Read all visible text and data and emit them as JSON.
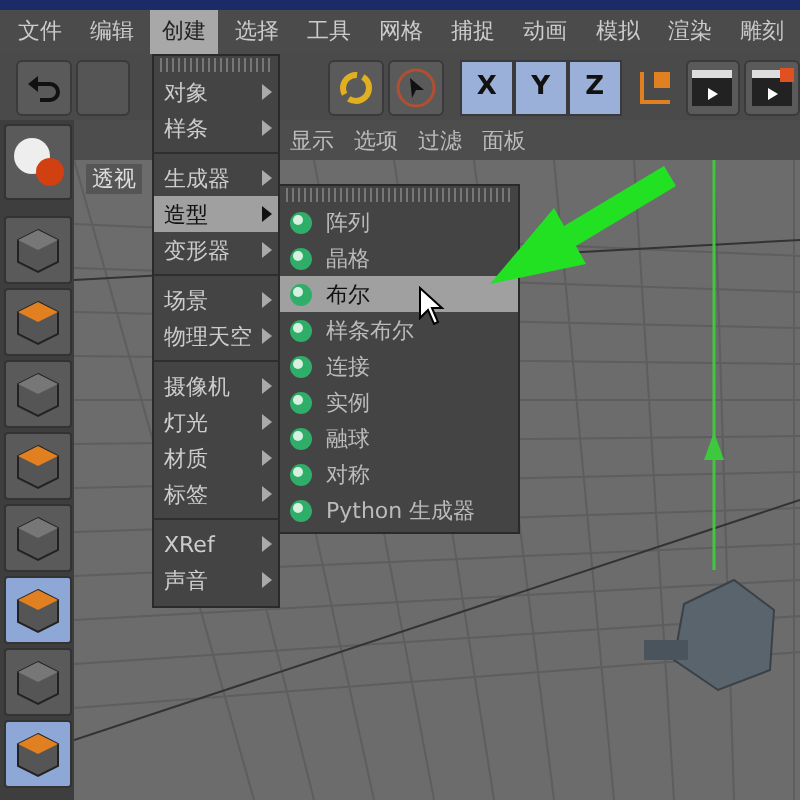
{
  "menu_bar": [
    {
      "label": "文件",
      "selected": false
    },
    {
      "label": "编辑",
      "selected": false
    },
    {
      "label": "创建",
      "selected": true
    },
    {
      "label": "选择",
      "selected": false
    },
    {
      "label": "工具",
      "selected": false
    },
    {
      "label": "网格",
      "selected": false
    },
    {
      "label": "捕捉",
      "selected": false
    },
    {
      "label": "动画",
      "selected": false
    },
    {
      "label": "模拟",
      "selected": false
    },
    {
      "label": "渲染",
      "selected": false
    },
    {
      "label": "雕刻",
      "selected": false
    }
  ],
  "axis_buttons": [
    {
      "label": "X",
      "selected": true
    },
    {
      "label": "Y",
      "selected": true
    },
    {
      "label": "Z",
      "selected": true
    }
  ],
  "left_tools": [
    {
      "selected": false
    },
    {
      "selected": false
    },
    {
      "selected": false
    },
    {
      "selected": false
    },
    {
      "selected": false
    },
    {
      "selected": true
    },
    {
      "selected": false
    },
    {
      "selected": true
    }
  ],
  "viewport": {
    "menu": [
      "显示",
      "选项",
      "过滤",
      "面板"
    ],
    "label": "透视"
  },
  "create_menu": {
    "groups": [
      [
        {
          "label": "对象",
          "selected": false
        },
        {
          "label": "样条",
          "selected": false
        }
      ],
      [
        {
          "label": "生成器",
          "selected": false
        },
        {
          "label": "造型",
          "selected": true
        },
        {
          "label": "变形器",
          "selected": false
        }
      ],
      [
        {
          "label": "场景",
          "selected": false
        },
        {
          "label": "物理天空",
          "selected": false
        }
      ],
      [
        {
          "label": "摄像机",
          "selected": false
        },
        {
          "label": "灯光",
          "selected": false
        },
        {
          "label": "材质",
          "selected": false
        },
        {
          "label": "标签",
          "selected": false
        }
      ],
      [
        {
          "label": "XRef",
          "selected": false
        },
        {
          "label": "声音",
          "selected": false
        }
      ]
    ]
  },
  "submenu": [
    {
      "label": "阵列",
      "selected": false
    },
    {
      "label": "晶格",
      "selected": false
    },
    {
      "label": "布尔",
      "selected": true
    },
    {
      "label": "样条布尔",
      "selected": false
    },
    {
      "label": "连接",
      "selected": false
    },
    {
      "label": "实例",
      "selected": false
    },
    {
      "label": "融球",
      "selected": false
    },
    {
      "label": "对称",
      "selected": false
    },
    {
      "label": "Python 生成器",
      "selected": false
    }
  ]
}
